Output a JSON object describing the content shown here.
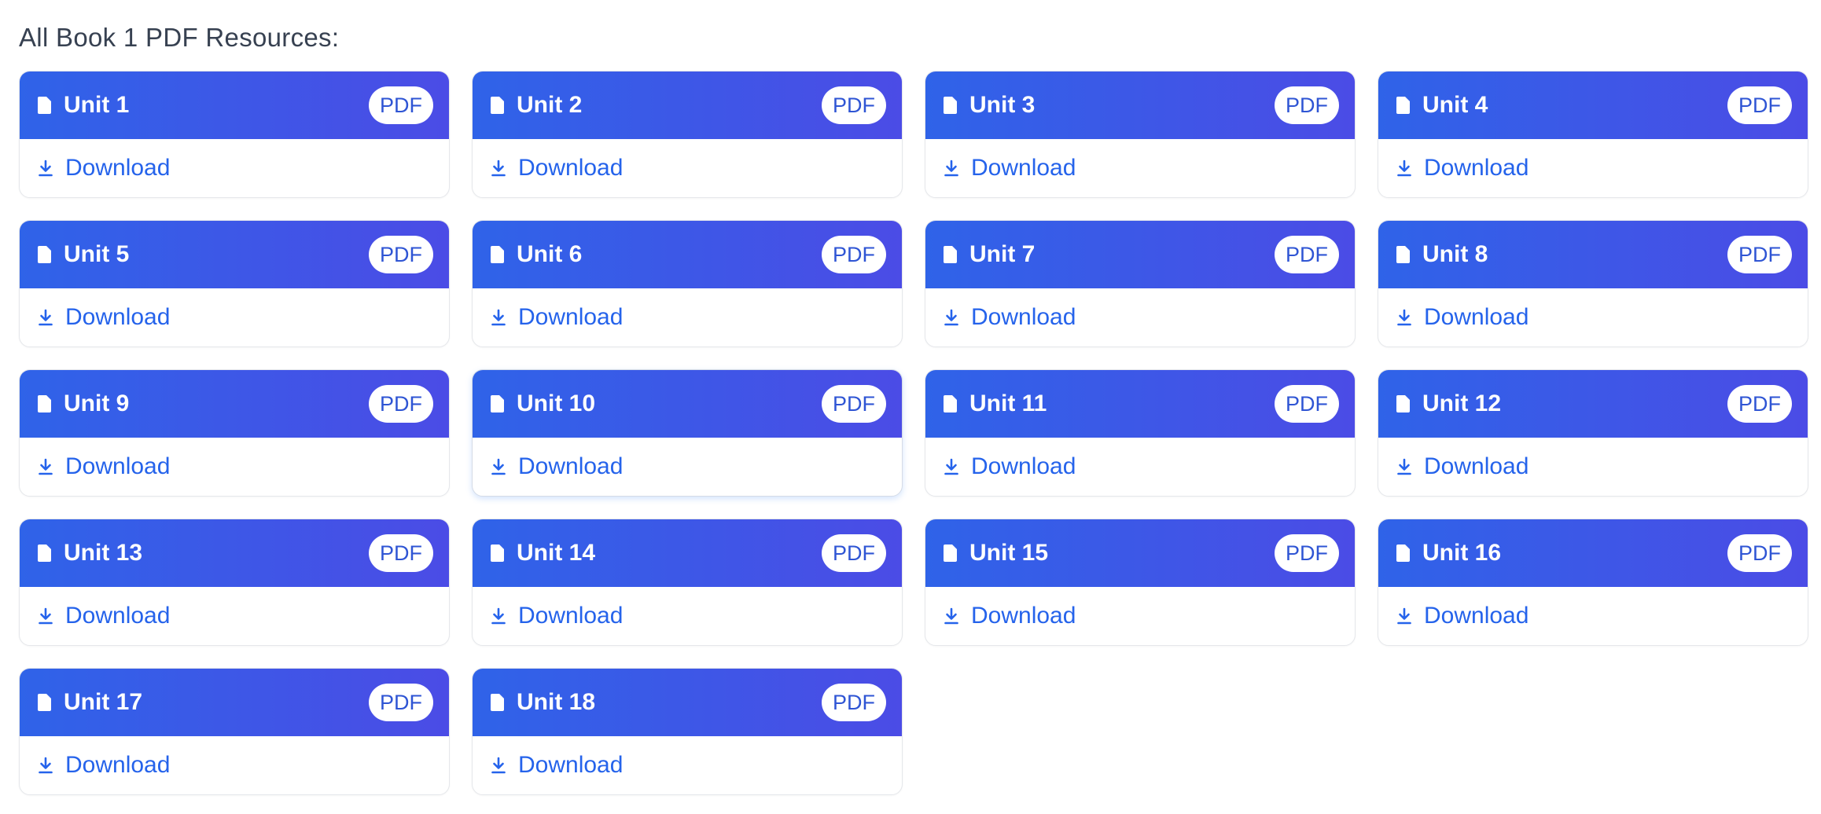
{
  "heading": "All Book 1 PDF Resources:",
  "badge_label": "PDF",
  "download_label": "Download",
  "colors": {
    "header_gradient_start": "#2f63e8",
    "header_gradient_end": "#4b4ce6",
    "link": "#2563eb"
  },
  "icons": {
    "header": "document-icon",
    "link": "download-icon"
  },
  "units": [
    {
      "title": "Unit 1"
    },
    {
      "title": "Unit 2"
    },
    {
      "title": "Unit 3"
    },
    {
      "title": "Unit 4"
    },
    {
      "title": "Unit 5"
    },
    {
      "title": "Unit 6"
    },
    {
      "title": "Unit 7"
    },
    {
      "title": "Unit 8"
    },
    {
      "title": "Unit 9"
    },
    {
      "title": "Unit 10",
      "hovered": true
    },
    {
      "title": "Unit 11"
    },
    {
      "title": "Unit 12"
    },
    {
      "title": "Unit 13"
    },
    {
      "title": "Unit 14"
    },
    {
      "title": "Unit 15"
    },
    {
      "title": "Unit 16"
    },
    {
      "title": "Unit 17"
    },
    {
      "title": "Unit 18"
    }
  ]
}
